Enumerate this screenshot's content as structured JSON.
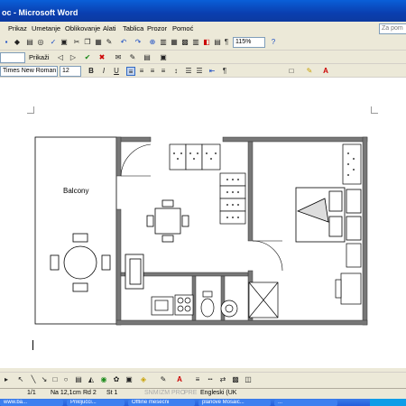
{
  "window": {
    "title": "oc - Microsoft Word"
  },
  "menu": {
    "items": [
      "Prikaz",
      "Umetanje",
      "Oblikovanje",
      "Alati",
      "Tablica",
      "Prozor",
      "Pomoć"
    ],
    "help_placeholder": "Za pom"
  },
  "toolbar": {
    "zoom": "115%",
    "style": "Prikaži",
    "font": "Times New Roman",
    "size": "12",
    "bold": "B",
    "italic": "I",
    "underline": "U",
    "para_mark": "¶"
  },
  "floorplan": {
    "balcony_label": "Balcony"
  },
  "status": {
    "page": "1/1",
    "at": "Na 12,1cm",
    "line": "Rd 2",
    "col": "St 1",
    "rec": "SNM",
    "trk": "IZM",
    "ext": "PRO",
    "ovr": "PRE",
    "lang": "Engleski (UK"
  },
  "taskbar": {
    "items": [
      "www.ba...",
      "Priključci...",
      "Offline mesecni",
      "planove Mosaic...",
      "..."
    ]
  }
}
